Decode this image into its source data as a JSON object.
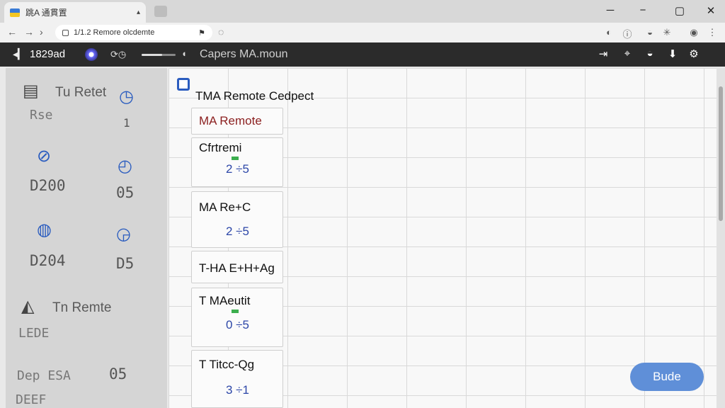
{
  "browser": {
    "tab_title": "跳A 通貫置",
    "tab_close": "▴",
    "url": "1/1.2 Remore olcdemte",
    "ext_icons": [
      "◐",
      "ⓘ",
      "◒",
      "✳",
      "◉",
      "⋮"
    ],
    "window_controls": [
      "─",
      "−",
      "▢",
      "✕"
    ]
  },
  "appbar": {
    "code": "1829ad",
    "title": "Capers MA.moun",
    "progress": 0.6
  },
  "sidebar": {
    "title": "Tu Retet",
    "sub": "Rse",
    "clock_value": "1",
    "rows": [
      {
        "left": "D200",
        "right": "05"
      },
      {
        "left": "D204",
        "right": "D5"
      }
    ],
    "footer_title": "Tn Remte",
    "footer_sub": "LEDE",
    "footer_left": "Dep ESA",
    "footer_left2": "DEEF",
    "footer_right": "05"
  },
  "main": {
    "title": "TMA Remote Cedpect",
    "cards": [
      {
        "label": "MA Remote",
        "value": ""
      },
      {
        "label": "Cfrtremi",
        "value": "2 ÷5"
      },
      {
        "label": "MA Re+C",
        "value": "2 ÷5"
      },
      {
        "label": "T-HA E+H+Ag",
        "value": ""
      },
      {
        "label": "T MAeutit",
        "value": "0 ÷5"
      },
      {
        "label": "T Titcc-Qg",
        "value": "3 ÷1"
      }
    ],
    "button_label": "Bude"
  }
}
